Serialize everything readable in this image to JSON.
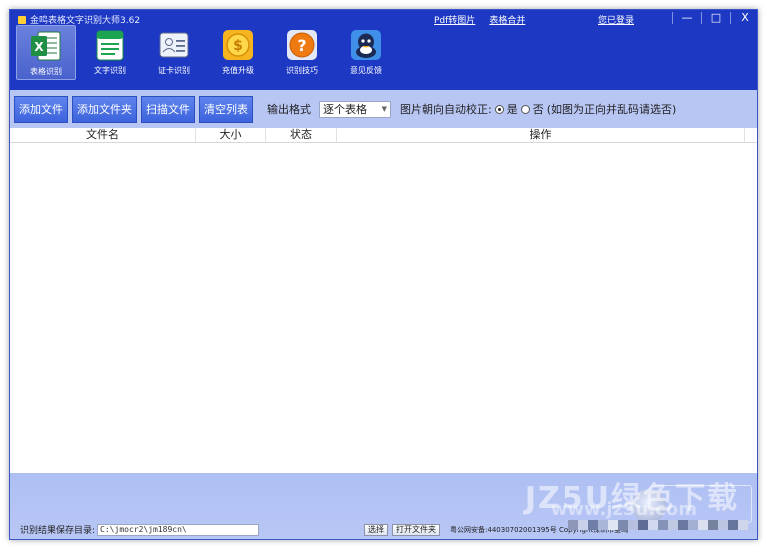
{
  "window": {
    "title": "金鸣表格文字识别大师3.62",
    "top_links": [
      "Pdf转图片",
      "表格合并"
    ],
    "login_text": "您已登录",
    "controls": [
      "—",
      "□",
      "X"
    ]
  },
  "tools": [
    {
      "label": "表格识别",
      "icon": "excel-icon",
      "active": true
    },
    {
      "label": "文字识别",
      "icon": "document-icon",
      "active": false
    },
    {
      "label": "证卡识别",
      "icon": "id-card-icon",
      "active": false
    },
    {
      "label": "充值升级",
      "icon": "coin-icon",
      "active": false
    },
    {
      "label": "识别技巧",
      "icon": "help-icon",
      "active": false
    },
    {
      "label": "意见反馈",
      "icon": "qq-penguin-icon",
      "active": false
    }
  ],
  "toolbar": {
    "buttons": [
      "添加文件",
      "添加文件夹",
      "扫描文件",
      "清空列表"
    ],
    "format_label": "输出格式",
    "format_value": "逐个表格",
    "orient_label": "图片朝向自动校正:",
    "orient_yes": "是",
    "orient_no": "否",
    "orient_note": "(如图为正向并乱码请选否)",
    "orient_selected": "是"
  },
  "table": {
    "columns": [
      "文件名",
      "大小",
      "状态",
      "操作"
    ],
    "rows": []
  },
  "bottom": {
    "save_label": "识别结果保存目录:",
    "save_path": "C:\\jmocr2\\jm189cn\\",
    "select_button": "选择",
    "open_folder_button": "打开文件夹",
    "icp_text": "粤公网安备:44030702001395号 Copyright深圳市金鸣",
    "watermark": "JZ5U绿色下载",
    "watermark_sub": "www.jz5u.com"
  },
  "colors": {
    "header_bg": "#1d39c4",
    "toolbar_bg": "#b8c6f4",
    "button_bg": "#3c63dc",
    "bottom_bg": "#aebff2"
  }
}
